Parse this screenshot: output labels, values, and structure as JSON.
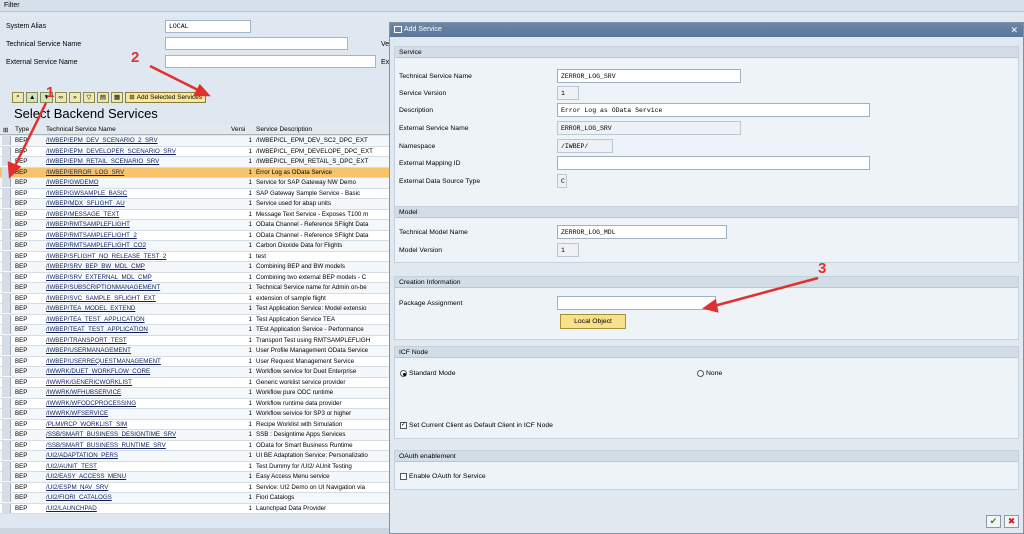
{
  "filter": {
    "title": "Filter",
    "system_alias_label": "System Alias",
    "system_alias_value": "LOCAL",
    "tech_name_label": "Technical Service Name",
    "tech_name_value": "",
    "ext_name_label": "External Service Name",
    "ext_name_value": "",
    "clipped_ve": "Ve",
    "clipped_ex": "Ex"
  },
  "toolbar": {
    "add_selected_label": "Add Selected Services"
  },
  "backend": {
    "title": "Select Backend Services",
    "columns": [
      "Type",
      "Technical Service Name",
      "Versi",
      "Service Description"
    ],
    "rows": [
      {
        "type": "BEP",
        "name": "/IWBEP/EPM_DEV_SCENARIO_2_SRV",
        "ver": "1",
        "desc": "/IWBEP/CL_EPM_DEV_SC2_DPC_EXT"
      },
      {
        "type": "BEP",
        "name": "/IWBEP/EPM_DEVELOPER_SCENARIO_SRV",
        "ver": "1",
        "desc": "/IWBEP/CL_EPM_DEVELOPE_DPC_EXT"
      },
      {
        "type": "BEP",
        "name": "/IWBEP/EPM_RETAIL_SCENARIO_SRV",
        "ver": "1",
        "desc": "/IWBEP/CL_EPM_RETAIL_S_DPC_EXT"
      },
      {
        "type": "BEP",
        "name": "/IWBEP/ERROR_LOG_SRV",
        "ver": "1",
        "desc": "Error Log as OData Service"
      },
      {
        "type": "BEP",
        "name": "/IWBEP/GWDEMO",
        "ver": "1",
        "desc": "Service for SAP Gateway NW Demo"
      },
      {
        "type": "BEP",
        "name": "/IWBEP/GWSAMPLE_BASIC",
        "ver": "1",
        "desc": "SAP Gateway Sample Service - Basic"
      },
      {
        "type": "BEP",
        "name": "/IWBEP/MDX_SFLIGHT_AU",
        "ver": "1",
        "desc": "Service used for abap units"
      },
      {
        "type": "BEP",
        "name": "/IWBEP/MESSAGE_TEXT",
        "ver": "1",
        "desc": "Message Text Service - Exposes T100 m"
      },
      {
        "type": "BEP",
        "name": "/IWBEP/RMTSAMPLEFLIGHT",
        "ver": "1",
        "desc": "OData Channel - Reference SFlight Data"
      },
      {
        "type": "BEP",
        "name": "/IWBEP/RMTSAMPLEFLIGHT_2",
        "ver": "1",
        "desc": "OData Channel - Reference SFlight Data"
      },
      {
        "type": "BEP",
        "name": "/IWBEP/RMTSAMPLEFLIGHT_CO2",
        "ver": "1",
        "desc": "Carbon Dioxide Data for Flights"
      },
      {
        "type": "BEP",
        "name": "/IWBEP/SFLIGHT_NO_RELEASE_TEST_2",
        "ver": "1",
        "desc": "test"
      },
      {
        "type": "BEP",
        "name": "/IWBEP/SRV_BEP_BW_MDL_CMP",
        "ver": "1",
        "desc": "Combining BEP and BW models"
      },
      {
        "type": "BEP",
        "name": "/IWBEP/SRV_EXTERNAL_MDL_CMP",
        "ver": "1",
        "desc": "Combining two external BEP models - C"
      },
      {
        "type": "BEP",
        "name": "/IWBEP/SUBSCRIPTIONMANAGEMENT",
        "ver": "1",
        "desc": "Technical Service name for Admin on-be"
      },
      {
        "type": "BEP",
        "name": "/IWBEP/SVC_SAMPLE_SFLIGHT_EXT",
        "ver": "1",
        "desc": "extension of sample flight"
      },
      {
        "type": "BEP",
        "name": "/IWBEP/TEA_MODEL_EXTEND",
        "ver": "1",
        "desc": "Test Application Service: Model extensio"
      },
      {
        "type": "BEP",
        "name": "/IWBEP/TEA_TEST_APPLICATION",
        "ver": "1",
        "desc": "Test Application Service TEA"
      },
      {
        "type": "BEP",
        "name": "/IWBEP/TEAT_TEST_APPLICATION",
        "ver": "1",
        "desc": "TEst Application Service - Performance"
      },
      {
        "type": "BEP",
        "name": "/IWBEP/TRANSPORT_TEST",
        "ver": "1",
        "desc": "Transport Test using RMTSAMPLEFLIGH"
      },
      {
        "type": "BEP",
        "name": "/IWBEP/USERMANAGEMENT",
        "ver": "1",
        "desc": "User Profile Management OData Service"
      },
      {
        "type": "BEP",
        "name": "/IWBEP/USERREQUESTMANAGEMENT",
        "ver": "1",
        "desc": "User Request Management Service"
      },
      {
        "type": "BEP",
        "name": "/IWWRK/DUET_WORKFLOW_CORE",
        "ver": "1",
        "desc": "Workflow service for Duet Enterprise"
      },
      {
        "type": "BEP",
        "name": "/IWWRK/GENERICWORKLIST",
        "ver": "1",
        "desc": "Generic worklist service provider"
      },
      {
        "type": "BEP",
        "name": "/IWWRK/WFHUBSERVICE",
        "ver": "1",
        "desc": "Workflow pure ODC runtime"
      },
      {
        "type": "BEP",
        "name": "/IWWRK/WFODCPROCESSING",
        "ver": "1",
        "desc": "Workflow runtime data provider"
      },
      {
        "type": "BEP",
        "name": "/IWWRK/WFSERVICE",
        "ver": "1",
        "desc": "Workflow service for SP3 or higher"
      },
      {
        "type": "BEP",
        "name": "/PLMI/RCP_WORKLIST_SIM",
        "ver": "1",
        "desc": "Recipe Worklist with Simulation"
      },
      {
        "type": "BEP",
        "name": "/SSB/SMART_BUSINESS_DESIGNTIME_SRV",
        "ver": "1",
        "desc": "SSB : Designtime Apps Services"
      },
      {
        "type": "BEP",
        "name": "/SSB/SMART_BUSINESS_RUNTIME_SRV",
        "ver": "1",
        "desc": "OData for Smart Business Runtime"
      },
      {
        "type": "BEP",
        "name": "/UI2/ADAPTATION_PERS",
        "ver": "1",
        "desc": "UI BE Adaptation Service: Personalizatio"
      },
      {
        "type": "BEP",
        "name": "/UI2/AUNIT_TEST",
        "ver": "1",
        "desc": "Test Dummy for /UI2/ AUnit Testing"
      },
      {
        "type": "BEP",
        "name": "/UI2/EASY_ACCESS_MENU",
        "ver": "1",
        "desc": "Easy Access Menu service"
      },
      {
        "type": "BEP",
        "name": "/UI2/ESPM_NAV_SRV",
        "ver": "1",
        "desc": "Service: UI2 Demo on UI Navigation via"
      },
      {
        "type": "BEP",
        "name": "/UI2/FIORI_CATALOGS",
        "ver": "1",
        "desc": "Fiori Catalogs"
      },
      {
        "type": "BEP",
        "name": "/UI2/LAUNCHPAD",
        "ver": "1",
        "desc": "Launchpad Data Provider"
      }
    ]
  },
  "dialog": {
    "title": "Add Service",
    "service": {
      "header": "Service",
      "tech_name_label": "Technical Service Name",
      "tech_name_value": "ZERROR_LOG_SRV",
      "version_label": "Service Version",
      "version_value": "1",
      "desc_label": "Description",
      "desc_value": "Error Log as OData Service",
      "ext_name_label": "External Service Name",
      "ext_name_value": "ERROR_LOG_SRV",
      "namespace_label": "Namespace",
      "namespace_value": "/IWBEP/",
      "ext_mapping_label": "External Mapping ID",
      "ext_mapping_value": "",
      "ext_source_label": "External Data Source Type",
      "ext_source_value": "C"
    },
    "model": {
      "header": "Model",
      "tech_model_label": "Technical Model Name",
      "tech_model_value": "ZERROR_LOG_MDL",
      "model_version_label": "Model Version",
      "model_version_value": "1"
    },
    "creation": {
      "header": "Creation Information",
      "package_label": "Package Assignment",
      "package_value": "",
      "local_object_label": "Local Object"
    },
    "icf": {
      "header": "ICF Node",
      "standard_label": "Standard Mode",
      "none_label": "None",
      "default_client_label": "Set Current Client as Default Client in ICF Node"
    },
    "oauth": {
      "header": "OAuth enablement",
      "enable_label": "Enable OAuth for Service"
    }
  },
  "annotations": {
    "m1": "1",
    "m2": "2",
    "m3": "3"
  }
}
